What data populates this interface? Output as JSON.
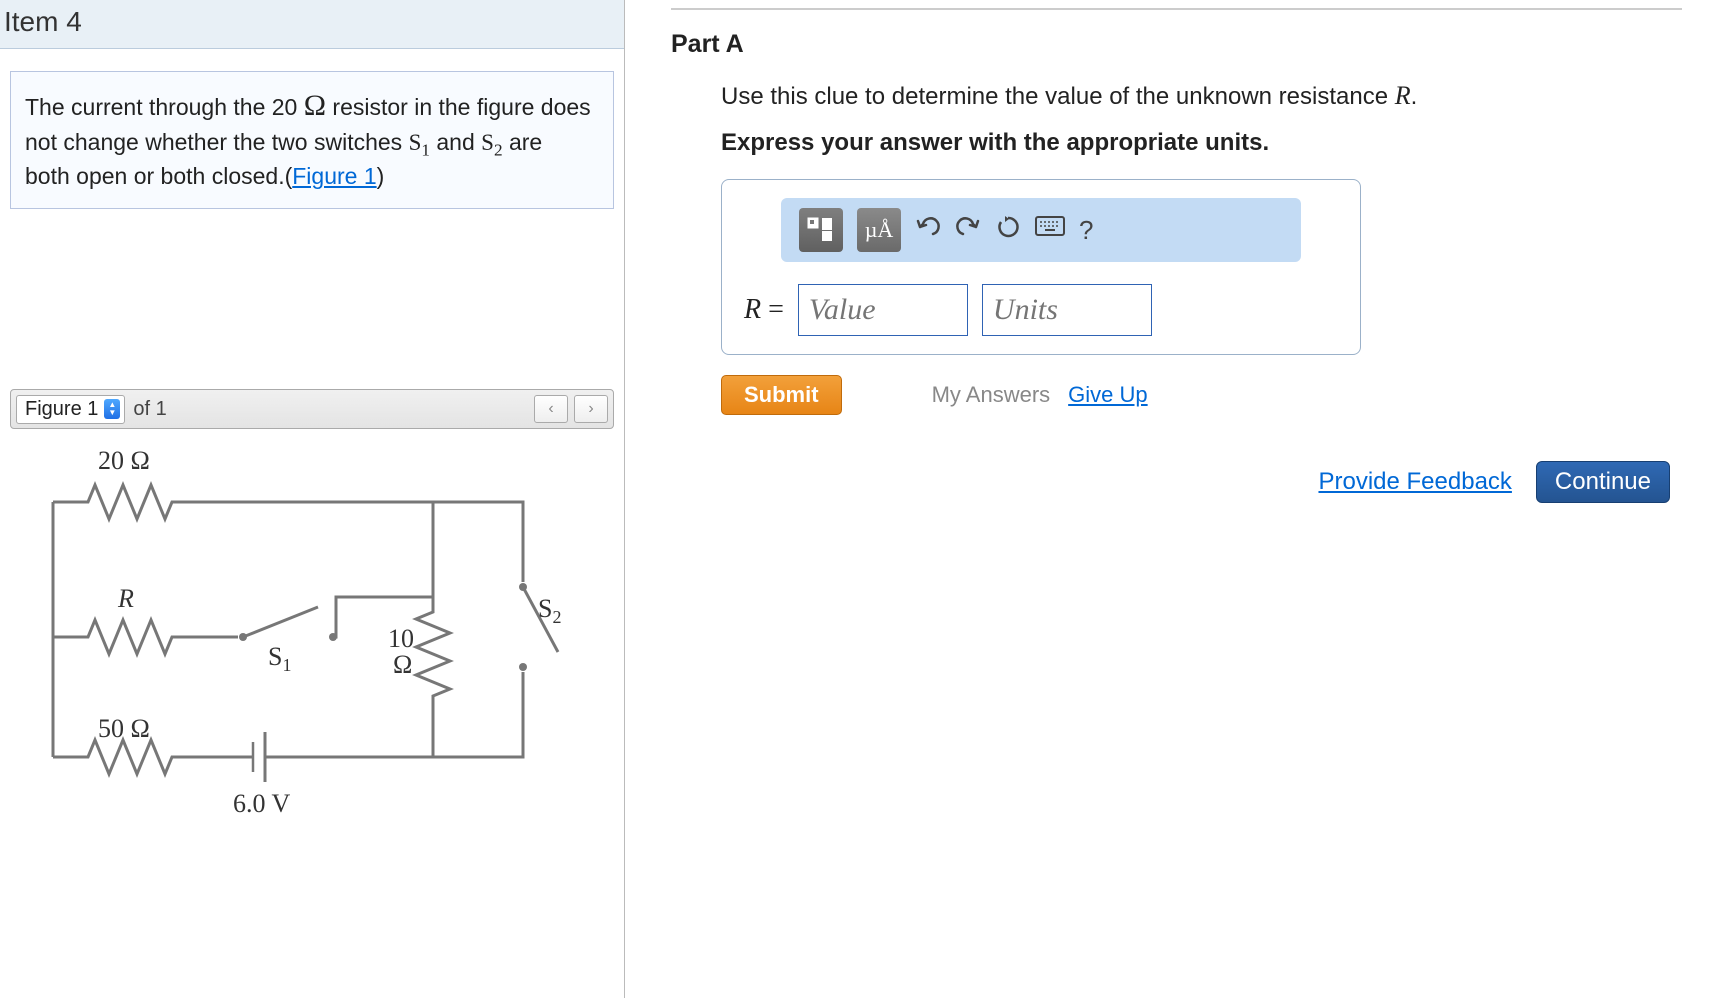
{
  "item_title": "Item 4",
  "prompt": {
    "line1a": "The current through the 20 ",
    "omega": "Ω",
    "line1b": " resistor in the figure does",
    "line2a": "not change whether the two switches ",
    "s1": "S",
    "s1sub": "1",
    "between": " and ",
    "s2": "S",
    "s2sub": "2",
    "line2b": " are",
    "line3a": "both open or both closed.(",
    "figlink": "Figure 1",
    "line3b": ")"
  },
  "figure_bar": {
    "label": "Figure 1",
    "of": "of 1"
  },
  "circuit": {
    "r20": "20 Ω",
    "R": "R",
    "s1": "S",
    "s1sub": "1",
    "r10": "10",
    "r10unit": "Ω",
    "s2": "S",
    "s2sub": "2",
    "r50": "50 Ω",
    "volt": "6.0 V"
  },
  "part": {
    "title": "Part A",
    "instruction": "Use this clue to determine the value of the unknown resistance ",
    "Rvar": "R",
    "period": ".",
    "units_instruction": "Express your answer with the appropriate units."
  },
  "toolbar": {
    "units_label": "µÅ",
    "help": "?"
  },
  "answer": {
    "label_R": "R",
    "label_eq": " =",
    "value_placeholder": "Value",
    "units_placeholder": "Units"
  },
  "buttons": {
    "submit": "Submit",
    "my_answers": "My Answers",
    "give_up": "Give Up",
    "provide_feedback": "Provide Feedback",
    "continue": "Continue"
  }
}
